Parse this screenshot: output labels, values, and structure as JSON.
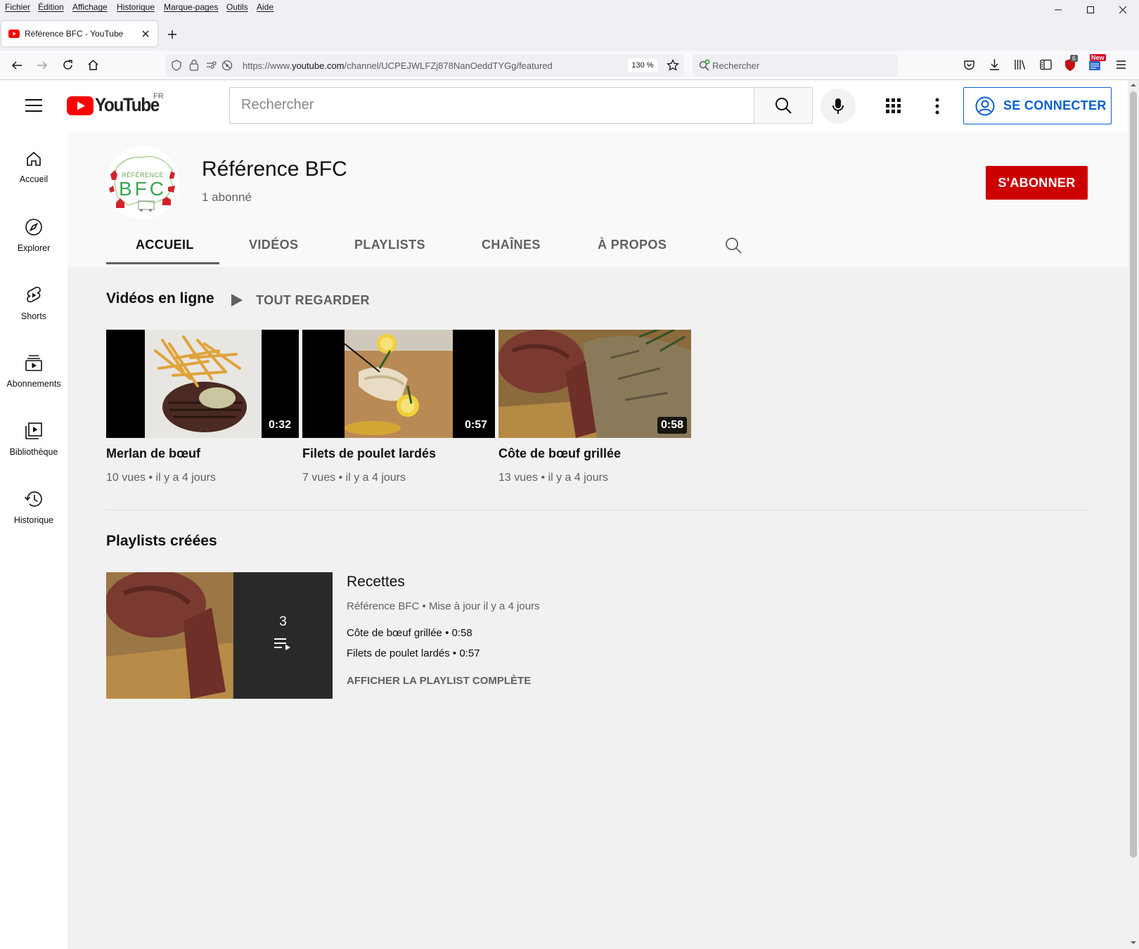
{
  "browser": {
    "menu": [
      "Fichier",
      "Édition",
      "Affichage",
      "Historique",
      "Marque-pages",
      "Outils",
      "Aide"
    ],
    "tab_title": "Référence BFC - YouTube",
    "url_prefix": "https://www.",
    "url_domain": "youtube.com",
    "url_path": "/channel/UCPEJWLFZj878NanOeddTYGg/featured",
    "zoom": "130 %",
    "search_placeholder": "Rechercher",
    "ublock_badge": "6",
    "new_badge": "New"
  },
  "youtube": {
    "logo_text": "YouTube",
    "region": "FR",
    "search_placeholder": "Rechercher",
    "signin_label": "SE CONNECTER",
    "sidebar": [
      {
        "label": "Accueil",
        "icon": "home-icon"
      },
      {
        "label": "Explorer",
        "icon": "compass-icon"
      },
      {
        "label": "Shorts",
        "icon": "shorts-icon"
      },
      {
        "label": "Abonnements",
        "icon": "subscriptions-icon"
      },
      {
        "label": "Bibliothèque",
        "icon": "library-icon"
      },
      {
        "label": "Historique",
        "icon": "history-icon"
      }
    ]
  },
  "channel": {
    "name": "Référence BFC",
    "subscribers": "1 abonné",
    "subscribe_label": "S'ABONNER",
    "logo_top": "RÉFÉRENCE",
    "logo_main": "BFC",
    "tabs": [
      "ACCUEIL",
      "VIDÉOS",
      "PLAYLISTS",
      "CHAÎNES",
      "À PROPOS"
    ],
    "active_tab": "ACCUEIL"
  },
  "videos_section": {
    "title": "Vidéos en ligne",
    "play_all": "TOUT REGARDER",
    "items": [
      {
        "title": "Merlan de bœuf",
        "duration": "0:32",
        "views": "10 vues",
        "age": "il y a 4 jours"
      },
      {
        "title": "Filets de poulet lardés",
        "duration": "0:57",
        "views": "7 vues",
        "age": "il y a 4 jours"
      },
      {
        "title": "Côte de bœuf grillée",
        "duration": "0:58",
        "views": "13 vues",
        "age": "il y a 4 jours"
      }
    ]
  },
  "playlists_section": {
    "title": "Playlists créées",
    "playlist": {
      "title": "Recettes",
      "count": "3",
      "owner": "Référence BFC",
      "updated": "Mise à jour il y a 4 jours",
      "items": [
        {
          "title": "Côte de bœuf grillée",
          "duration": "0:58"
        },
        {
          "title": "Filets de poulet lardés",
          "duration": "0:57"
        }
      ],
      "view_full": "AFFICHER LA PLAYLIST COMPLÈTE"
    }
  },
  "colors": {
    "yt_red": "#ff0000",
    "subscribe_red": "#cc0000",
    "signin_blue": "#065fd4"
  }
}
